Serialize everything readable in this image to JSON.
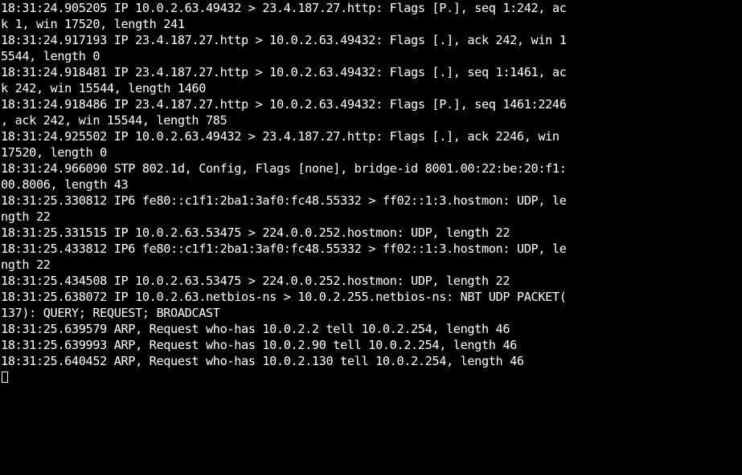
{
  "terminal": {
    "colors": {
      "background": "#000000",
      "foreground": "#ffffff"
    },
    "lines": [
      "18:31:24.905205 IP 10.0.2.63.49432 > 23.4.187.27.http: Flags [P.], seq 1:242, ac",
      "k 1, win 17520, length 241",
      "18:31:24.917193 IP 23.4.187.27.http > 10.0.2.63.49432: Flags [.], ack 242, win 1",
      "5544, length 0",
      "18:31:24.918481 IP 23.4.187.27.http > 10.0.2.63.49432: Flags [.], seq 1:1461, ac",
      "k 242, win 15544, length 1460",
      "18:31:24.918486 IP 23.4.187.27.http > 10.0.2.63.49432: Flags [P.], seq 1461:2246",
      ", ack 242, win 15544, length 785",
      "18:31:24.925502 IP 10.0.2.63.49432 > 23.4.187.27.http: Flags [.], ack 2246, win",
      "17520, length 0",
      "18:31:24.966090 STP 802.1d, Config, Flags [none], bridge-id 8001.00:22:be:20:f1:",
      "00.8006, length 43",
      "18:31:25.330812 IP6 fe80::c1f1:2ba1:3af0:fc48.55332 > ff02::1:3.hostmon: UDP, le",
      "ngth 22",
      "18:31:25.331515 IP 10.0.2.63.53475 > 224.0.0.252.hostmon: UDP, length 22",
      "18:31:25.433812 IP6 fe80::c1f1:2ba1:3af0:fc48.55332 > ff02::1:3.hostmon: UDP, le",
      "ngth 22",
      "18:31:25.434508 IP 10.0.2.63.53475 > 224.0.0.252.hostmon: UDP, length 22",
      "18:31:25.638072 IP 10.0.2.63.netbios-ns > 10.0.2.255.netbios-ns: NBT UDP PACKET(",
      "137): QUERY; REQUEST; BROADCAST",
      "18:31:25.639579 ARP, Request who-has 10.0.2.2 tell 10.0.2.254, length 46",
      "18:31:25.639993 ARP, Request who-has 10.0.2.90 tell 10.0.2.254, length 46",
      "18:31:25.640452 ARP, Request who-has 10.0.2.130 tell 10.0.2.254, length 46"
    ],
    "cursor_icon": "block-cursor-icon"
  }
}
